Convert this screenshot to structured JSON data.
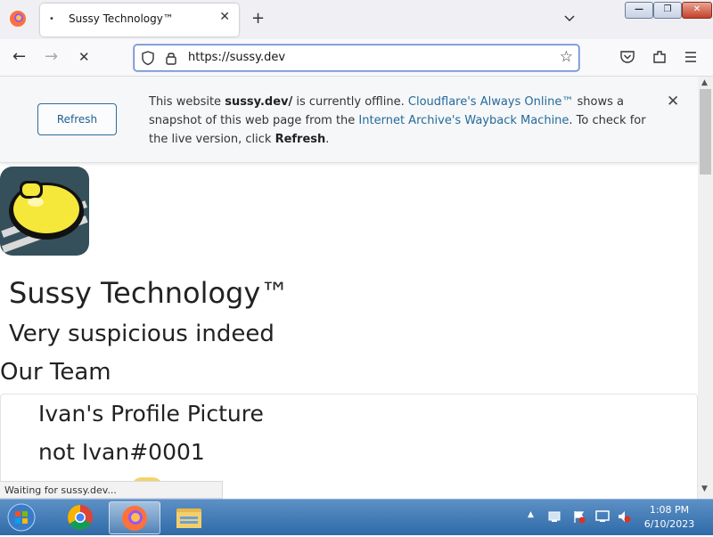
{
  "browser": {
    "tab": {
      "title": "Sussy Technology™",
      "close": "✕",
      "loading_dot": "•"
    },
    "new_tab": "+",
    "url": "https://sussy.dev",
    "nav": {
      "back": "←",
      "forward": "→",
      "stop": "✕"
    },
    "icons": [
      "firefox-icon",
      "shield-icon",
      "lock-icon",
      "star-icon",
      "pocket-icon",
      "extensions-icon",
      "menu-icon"
    ],
    "window_controls": {
      "minimize": "—",
      "maximize": "❐",
      "close": "✕"
    }
  },
  "banner": {
    "refresh_label": "Refresh",
    "t1": "This website ",
    "site": "sussy.dev/",
    "t2": " is currently offline. ",
    "link1": "Cloudflare's Always Online™",
    "t3": " shows a snapshot of this web page from the ",
    "link2": "Internet Archive's Wayback Machine",
    "t4": ". To check for the live version, click ",
    "refresh_word": "Refresh",
    "t5": ".",
    "close": "✕"
  },
  "page": {
    "title": "Sussy Technology™",
    "subtitle": "Very suspicious indeed",
    "section": "Our Team",
    "team": [
      {
        "picture_alt": "Ivan's Profile Picture",
        "name": "not Ivan#0001"
      }
    ]
  },
  "status_text": "Waiting for sussy.dev...",
  "taskbar": {
    "apps": [
      "start-button",
      "chrome-icon",
      "firefox-icon",
      "file-explorer-icon"
    ],
    "clock_time": "1:08 PM",
    "clock_date": "6/10/2023",
    "tray_arrow": "▲"
  },
  "colors": {
    "link": "#246a9c",
    "accent": "#1f5f8f",
    "taskbar": "#2f6ba8"
  }
}
